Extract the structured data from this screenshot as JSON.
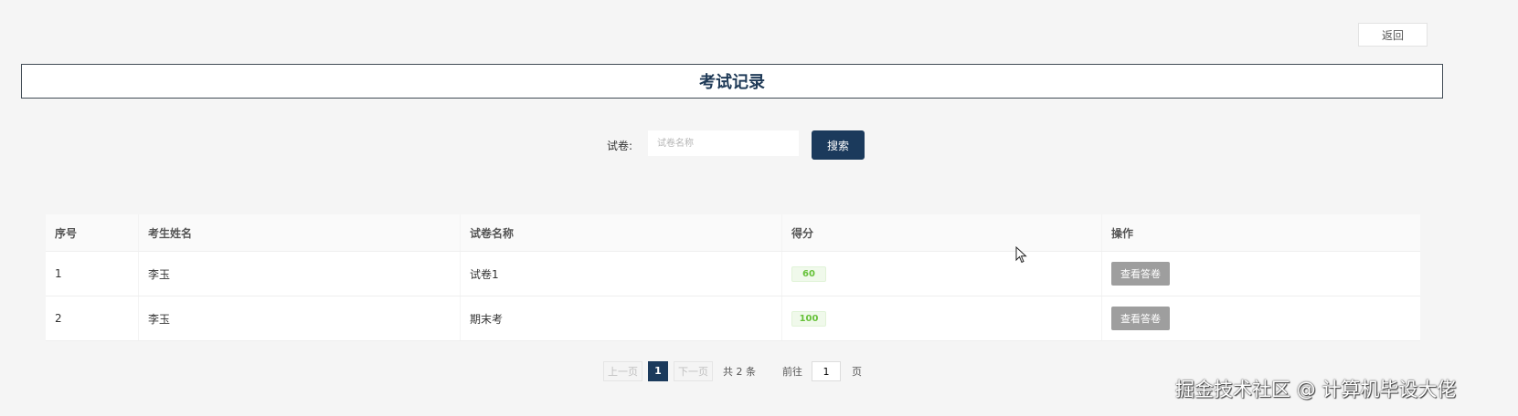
{
  "header": {
    "back_label": "返回",
    "title": "考试记录"
  },
  "search": {
    "label": "试卷:",
    "placeholder": "试卷名称",
    "button_label": "搜索"
  },
  "table": {
    "columns": [
      "序号",
      "考生姓名",
      "试卷名称",
      "得分",
      "操作"
    ],
    "rows": [
      {
        "index": "1",
        "name": "李玉",
        "paper": "试卷1",
        "score": "60",
        "action": "查看答卷"
      },
      {
        "index": "2",
        "name": "李玉",
        "paper": "期末考",
        "score": "100",
        "action": "查看答卷"
      }
    ]
  },
  "pagination": {
    "prev_label": "上一页",
    "current_page": "1",
    "next_label": "下一页",
    "total_label": "共 2 条",
    "goto_label": "前往",
    "goto_value": "1",
    "page_suffix": "页"
  },
  "watermark": "掘金技术社区 @ 计算机毕设大佬",
  "colors": {
    "primary": "#1b3a5c",
    "score": "#67c23a",
    "action_button": "#9e9e9e"
  }
}
